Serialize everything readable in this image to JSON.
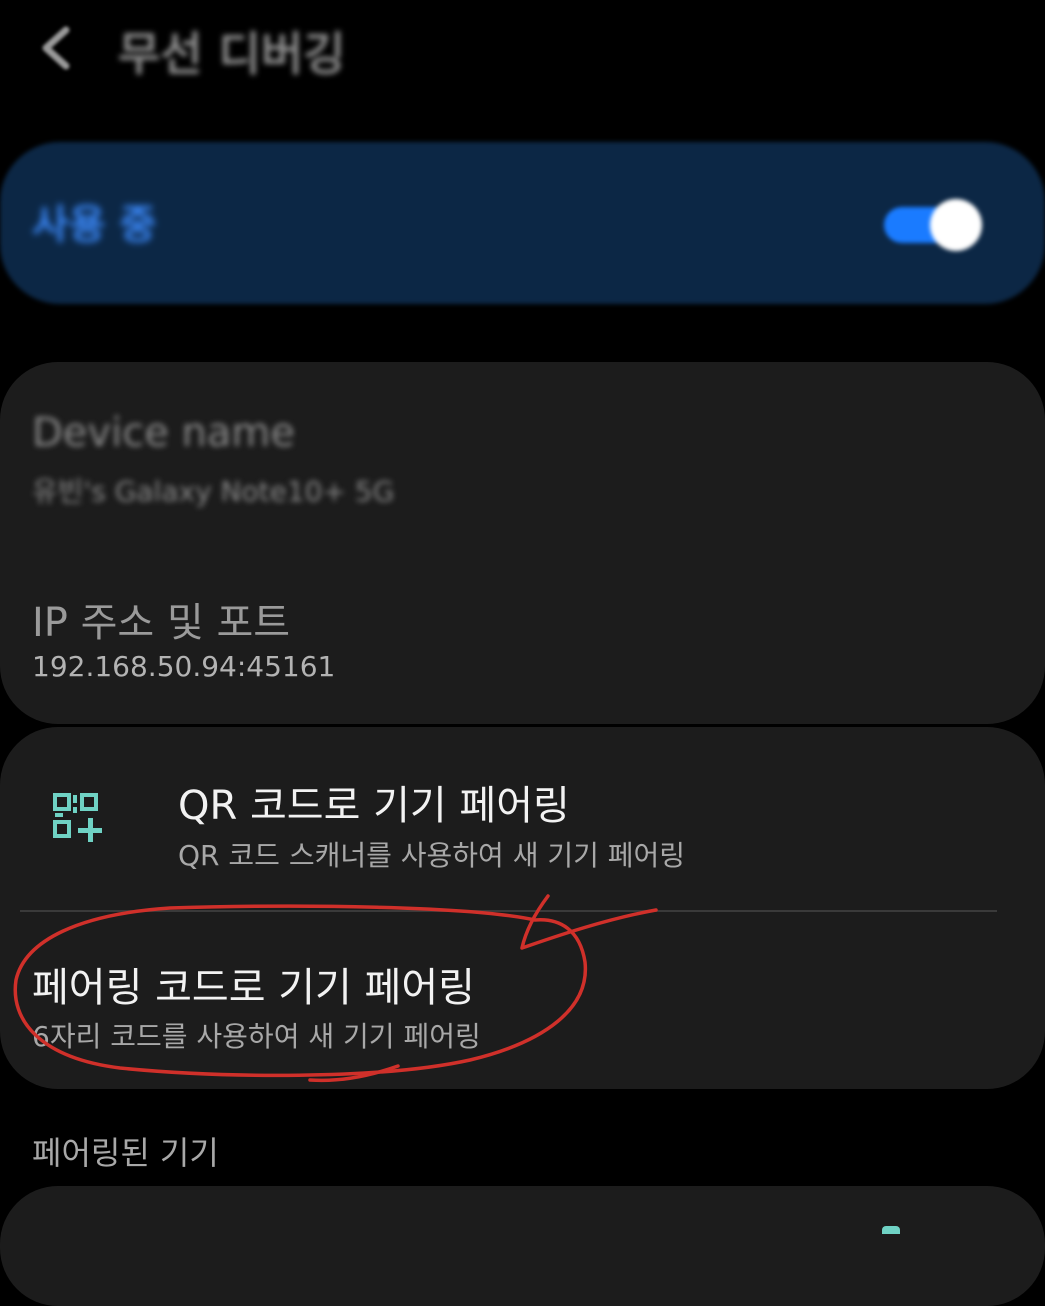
{
  "header": {
    "title": "무선 디버깅",
    "back_icon": "chevron-left-icon"
  },
  "toggle": {
    "label": "사용 중",
    "state": "on",
    "accent_color": "#1a7bff"
  },
  "info": {
    "device_name_title": "Device name",
    "device_name_value": "유빈's Galaxy Note10+ 5G",
    "ip_title": "IP 주소 및 포트",
    "ip_value": "192.168.50.94:45161"
  },
  "pairing": {
    "qr_icon": "qr-add-icon",
    "qr_title": "QR 코드로 기기 페어링",
    "qr_subtitle": "QR 코드 스캐너를 사용하여 새 기기 페어링",
    "code_title": "페어링 코드로 기기 페어링",
    "code_subtitle": "6자리 코드를 사용하여 새 기기 페어링"
  },
  "paired_section": {
    "header": "페어링된 기기"
  },
  "annotation": {
    "color": "#d0302a",
    "shape": "hand-drawn ellipse with checkmark"
  }
}
